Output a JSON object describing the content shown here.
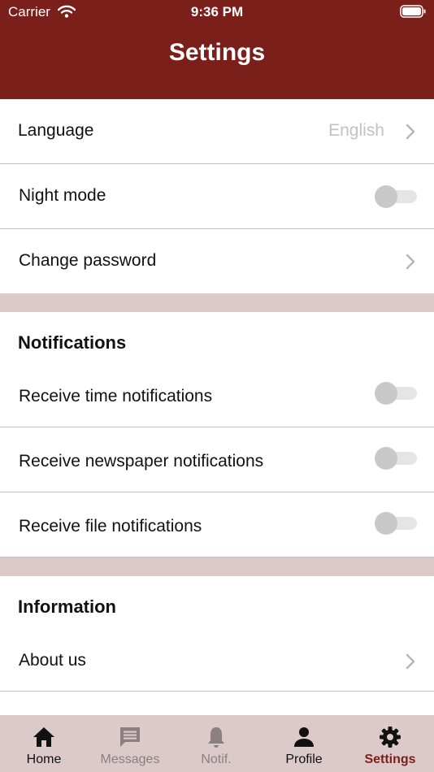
{
  "status_bar": {
    "carrier": "Carrier",
    "time": "9:36 PM"
  },
  "header": {
    "title": "Settings"
  },
  "general": {
    "language": {
      "label": "Language",
      "value": "English"
    },
    "night_mode": {
      "label": "Night mode",
      "enabled": false
    },
    "change_password": {
      "label": "Change password"
    }
  },
  "notifications": {
    "title": "Notifications",
    "time": {
      "label": "Receive time notifications",
      "enabled": false
    },
    "newspaper": {
      "label": "Receive newspaper notifications",
      "enabled": false
    },
    "file": {
      "label": "Receive file notifications",
      "enabled": false
    }
  },
  "information": {
    "title": "Information",
    "about": {
      "label": "About us"
    }
  },
  "tabs": [
    {
      "label": "Home",
      "icon": "home-icon",
      "active": false
    },
    {
      "label": "Messages",
      "icon": "message-icon",
      "active": false
    },
    {
      "label": "Notif.",
      "icon": "bell-icon",
      "active": false
    },
    {
      "label": "Profile",
      "icon": "person-icon",
      "active": false
    },
    {
      "label": "Settings",
      "icon": "gear-icon",
      "active": true
    }
  ],
  "colors": {
    "brand": "#7b1f1a",
    "separator": "#dcc9c9",
    "tab_default": "#111111",
    "tab_muted": "#8a8080",
    "tab_active": "#7b1f1a"
  }
}
